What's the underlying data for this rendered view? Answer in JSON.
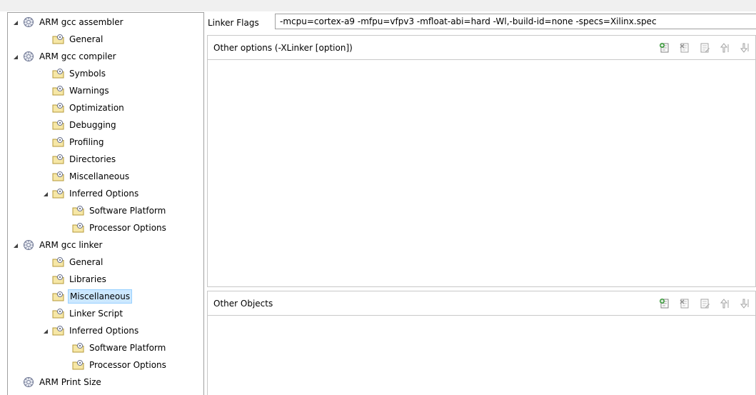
{
  "tree": {
    "items": [
      {
        "label": "ARM gcc assembler",
        "icon": "tool-icon",
        "expanded": true
      },
      {
        "label": "General",
        "icon": "category-icon"
      },
      {
        "label": "ARM gcc compiler",
        "icon": "tool-icon",
        "expanded": true
      },
      {
        "label": "Symbols",
        "icon": "category-icon"
      },
      {
        "label": "Warnings",
        "icon": "category-icon"
      },
      {
        "label": "Optimization",
        "icon": "category-icon"
      },
      {
        "label": "Debugging",
        "icon": "category-icon"
      },
      {
        "label": "Profiling",
        "icon": "category-icon"
      },
      {
        "label": "Directories",
        "icon": "category-icon"
      },
      {
        "label": "Miscellaneous",
        "icon": "category-icon"
      },
      {
        "label": "Inferred Options",
        "icon": "category-icon",
        "expanded": true
      },
      {
        "label": "Software Platform",
        "icon": "category-icon"
      },
      {
        "label": "Processor Options",
        "icon": "category-icon"
      },
      {
        "label": "ARM gcc linker",
        "icon": "tool-icon",
        "expanded": true
      },
      {
        "label": "General",
        "icon": "category-icon"
      },
      {
        "label": "Libraries",
        "icon": "category-icon"
      },
      {
        "label": "Miscellaneous",
        "icon": "category-icon",
        "selected": true
      },
      {
        "label": "Linker Script",
        "icon": "category-icon"
      },
      {
        "label": "Inferred Options",
        "icon": "category-icon",
        "expanded": true
      },
      {
        "label": "Software Platform",
        "icon": "category-icon"
      },
      {
        "label": "Processor Options",
        "icon": "category-icon"
      },
      {
        "label": "ARM Print Size",
        "icon": "tool-icon"
      }
    ]
  },
  "linker_flags": {
    "label": "Linker Flags",
    "value": "-mcpu=cortex-a9 -mfpu=vfpv3 -mfloat-abi=hard -Wl,-build-id=none -specs=Xilinx.spec"
  },
  "other_options": {
    "title": "Other options (-XLinker [option])"
  },
  "other_objects": {
    "title": "Other Objects"
  },
  "toolbar_icons": [
    "add-icon",
    "delete-icon",
    "edit-icon",
    "move-up-icon",
    "move-down-icon"
  ],
  "colors": {
    "selection_bg": "#cce8ff",
    "selection_border": "#99d1ff",
    "border": "#a0a0a0",
    "section_border": "#c8c8c8"
  }
}
